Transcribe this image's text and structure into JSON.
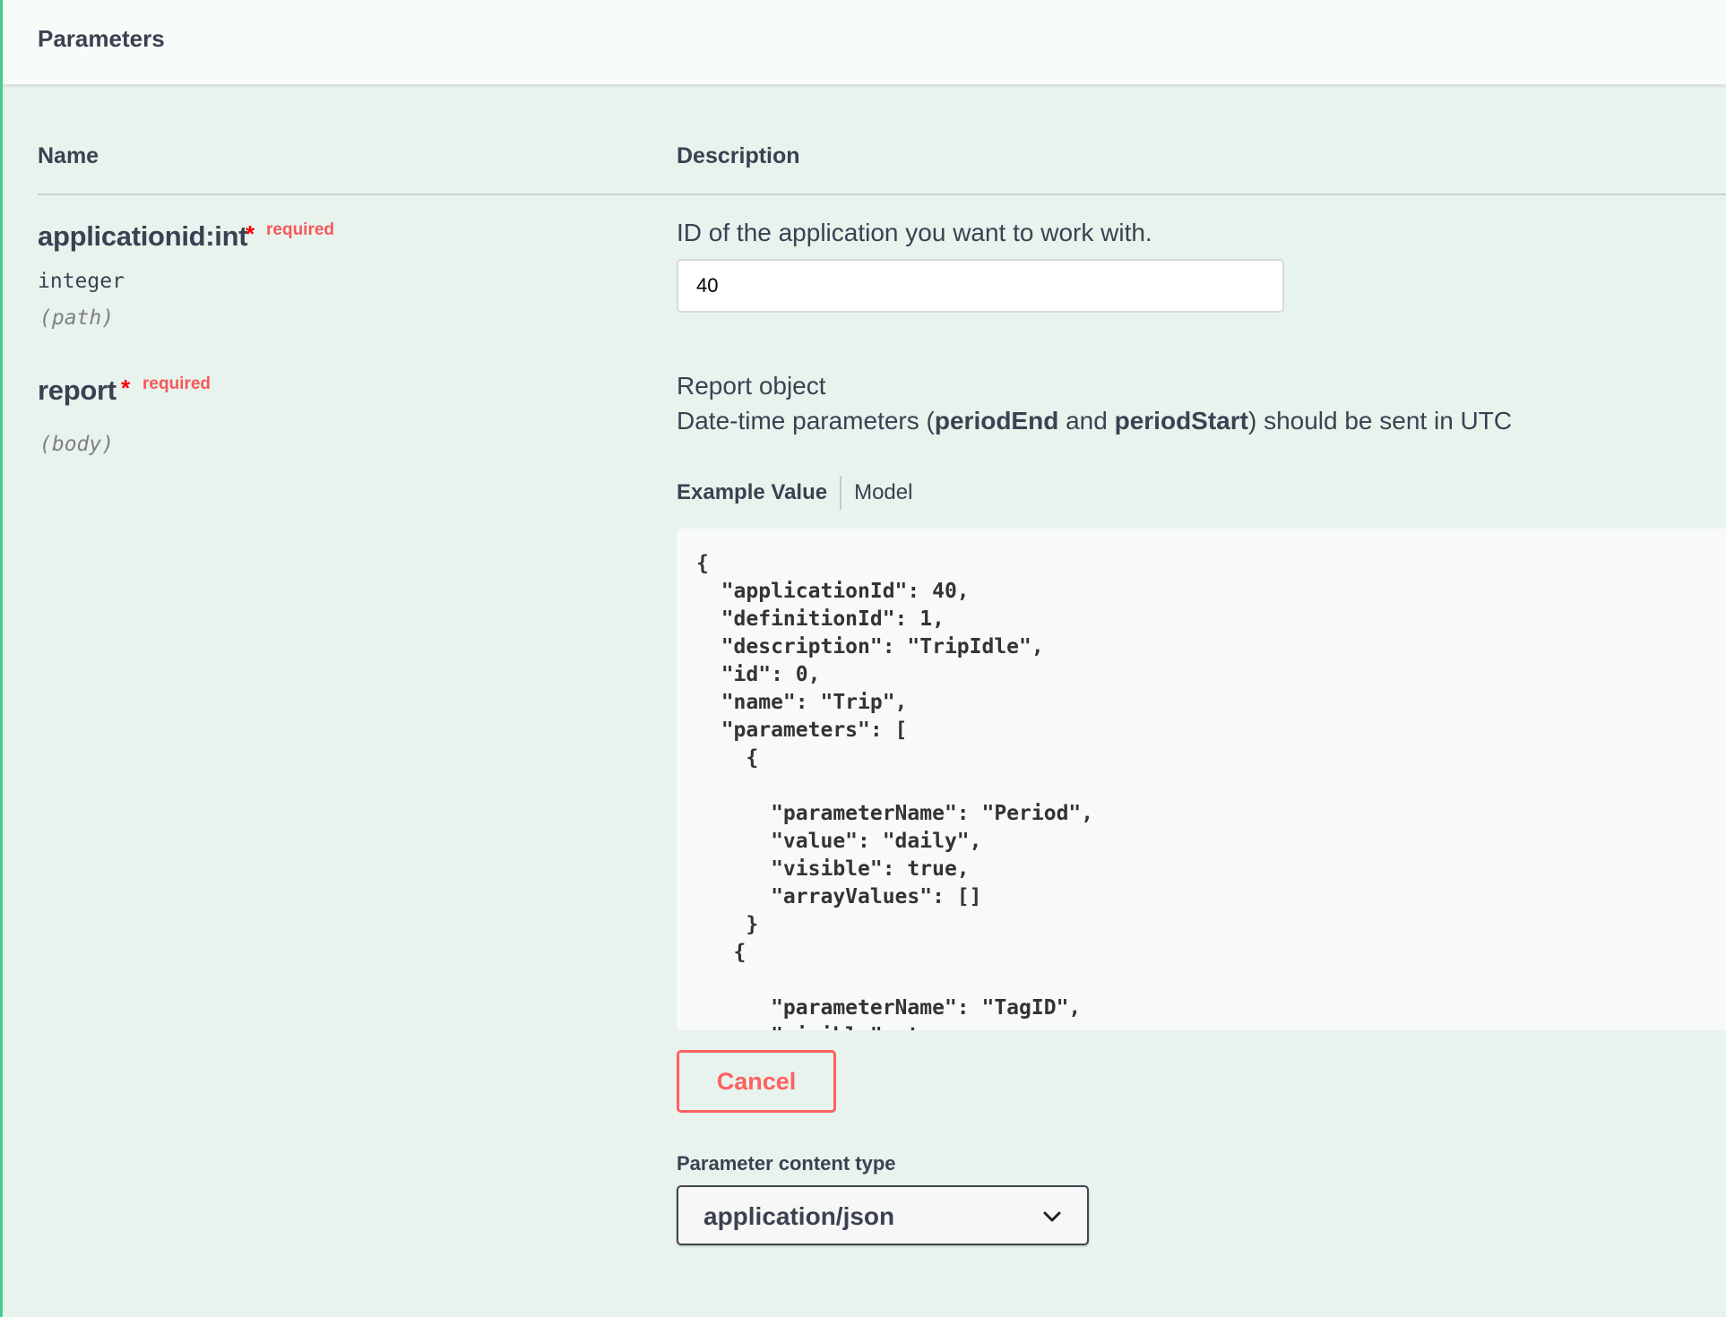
{
  "section": {
    "title": "Parameters"
  },
  "columns": {
    "name": "Name",
    "description": "Description"
  },
  "params": [
    {
      "name": "applicationid:int",
      "required_mark": "*",
      "required_label": "required",
      "type": "integer",
      "in": "(path)",
      "description": "ID of the application you want to work with.",
      "value": "40"
    },
    {
      "name": "report",
      "required_mark": "*",
      "required_label": "required",
      "in": "(body)",
      "description_line1": "Report object",
      "description_line2_pre": "Date-time parameters (",
      "description_line2_b1": "periodEnd",
      "description_line2_mid": " and ",
      "description_line2_b2": "periodStart",
      "description_line2_post": ") should be sent in UTC",
      "tabs": {
        "example": "Example Value",
        "model": "Model"
      },
      "example_json": "{\n  \"applicationId\": 40,\n  \"definitionId\": 1,\n  \"description\": \"TripIdle\",\n  \"id\": 0,\n  \"name\": \"Trip\",\n  \"parameters\": [\n    {\n\n      \"parameterName\": \"Period\",\n      \"value\": \"daily\",\n      \"visible\": true,\n      \"arrayValues\": []\n    }\n   {\n\n      \"parameterName\": \"TagID\",\n      \"visible\": true,",
      "cancel_label": "Cancel",
      "content_type_label": "Parameter content type",
      "content_type_value": "application/json"
    }
  ],
  "colors": {
    "accent_green": "#49cc90",
    "required_red": "#f93e3e",
    "cancel_red": "#ff6060",
    "background": "#e8f3ee"
  },
  "icons": {
    "select": "chevron-down-icon"
  }
}
